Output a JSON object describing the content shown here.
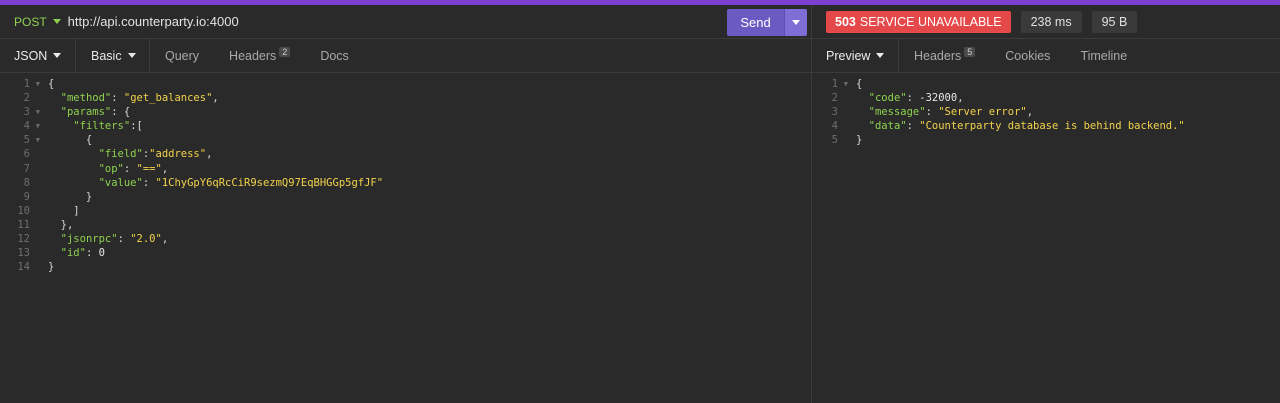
{
  "request": {
    "method": "POST",
    "url": "http://api.counterparty.io:4000",
    "send_label": "Send"
  },
  "response": {
    "status_code": "503",
    "status_text": "SERVICE UNAVAILABLE",
    "time": "238 ms",
    "size": "95 B"
  },
  "request_tabs": [
    {
      "label": "JSON"
    },
    {
      "label": "Basic"
    },
    {
      "label": "Query"
    },
    {
      "label": "Headers",
      "count": "2"
    },
    {
      "label": "Docs"
    }
  ],
  "response_tabs": [
    {
      "label": "Preview"
    },
    {
      "label": "Headers",
      "count": "5"
    },
    {
      "label": "Cookies"
    },
    {
      "label": "Timeline"
    }
  ],
  "request_body": [
    {
      "num": "1",
      "fold": true,
      "tokens": [
        {
          "t": "p",
          "v": "{"
        }
      ]
    },
    {
      "num": "2",
      "fold": false,
      "tokens": [
        {
          "t": "p",
          "v": "  "
        },
        {
          "t": "k",
          "v": "\"method\""
        },
        {
          "t": "p",
          "v": ": "
        },
        {
          "t": "s",
          "v": "\"get_balances\""
        },
        {
          "t": "p",
          "v": ","
        }
      ]
    },
    {
      "num": "3",
      "fold": true,
      "tokens": [
        {
          "t": "p",
          "v": "  "
        },
        {
          "t": "k",
          "v": "\"params\""
        },
        {
          "t": "p",
          "v": ": {"
        }
      ]
    },
    {
      "num": "4",
      "fold": true,
      "tokens": [
        {
          "t": "p",
          "v": "    "
        },
        {
          "t": "k",
          "v": "\"filters\""
        },
        {
          "t": "p",
          "v": ":["
        }
      ]
    },
    {
      "num": "5",
      "fold": true,
      "tokens": [
        {
          "t": "p",
          "v": "      {"
        }
      ]
    },
    {
      "num": "6",
      "fold": false,
      "tokens": [
        {
          "t": "p",
          "v": "        "
        },
        {
          "t": "k",
          "v": "\"field\""
        },
        {
          "t": "p",
          "v": ":"
        },
        {
          "t": "s",
          "v": "\"address\""
        },
        {
          "t": "p",
          "v": ","
        }
      ]
    },
    {
      "num": "7",
      "fold": false,
      "tokens": [
        {
          "t": "p",
          "v": "        "
        },
        {
          "t": "k",
          "v": "\"op\""
        },
        {
          "t": "p",
          "v": ": "
        },
        {
          "t": "s",
          "v": "\"==\""
        },
        {
          "t": "p",
          "v": ","
        }
      ]
    },
    {
      "num": "8",
      "fold": false,
      "tokens": [
        {
          "t": "p",
          "v": "        "
        },
        {
          "t": "k",
          "v": "\"value\""
        },
        {
          "t": "p",
          "v": ": "
        },
        {
          "t": "s",
          "v": "\"1ChyGpY6qRcCiR9sezmQ97EqBHGGp5gfJF\""
        }
      ]
    },
    {
      "num": "9",
      "fold": false,
      "tokens": [
        {
          "t": "p",
          "v": "      }"
        }
      ]
    },
    {
      "num": "10",
      "fold": false,
      "tokens": [
        {
          "t": "p",
          "v": "    ]"
        }
      ]
    },
    {
      "num": "11",
      "fold": false,
      "tokens": [
        {
          "t": "p",
          "v": "  },"
        }
      ]
    },
    {
      "num": "12",
      "fold": false,
      "tokens": [
        {
          "t": "p",
          "v": "  "
        },
        {
          "t": "k",
          "v": "\"jsonrpc\""
        },
        {
          "t": "p",
          "v": ": "
        },
        {
          "t": "s",
          "v": "\"2.0\""
        },
        {
          "t": "p",
          "v": ","
        }
      ]
    },
    {
      "num": "13",
      "fold": false,
      "tokens": [
        {
          "t": "p",
          "v": "  "
        },
        {
          "t": "k",
          "v": "\"id\""
        },
        {
          "t": "p",
          "v": ": "
        },
        {
          "t": "n",
          "v": "0"
        }
      ]
    },
    {
      "num": "14",
      "fold": false,
      "tokens": [
        {
          "t": "p",
          "v": "}"
        }
      ]
    }
  ],
  "response_body": [
    {
      "num": "1",
      "fold": true,
      "tokens": [
        {
          "t": "p",
          "v": "{"
        }
      ]
    },
    {
      "num": "2",
      "fold": false,
      "tokens": [
        {
          "t": "p",
          "v": "  "
        },
        {
          "t": "k",
          "v": "\"code\""
        },
        {
          "t": "p",
          "v": ": "
        },
        {
          "t": "n",
          "v": "-32000"
        },
        {
          "t": "p",
          "v": ","
        }
      ]
    },
    {
      "num": "3",
      "fold": false,
      "tokens": [
        {
          "t": "p",
          "v": "  "
        },
        {
          "t": "k",
          "v": "\"message\""
        },
        {
          "t": "p",
          "v": ": "
        },
        {
          "t": "s",
          "v": "\"Server error\""
        },
        {
          "t": "p",
          "v": ","
        }
      ]
    },
    {
      "num": "4",
      "fold": false,
      "tokens": [
        {
          "t": "p",
          "v": "  "
        },
        {
          "t": "k",
          "v": "\"data\""
        },
        {
          "t": "p",
          "v": ": "
        },
        {
          "t": "s",
          "v": "\"Counterparty database is behind backend.\""
        }
      ]
    },
    {
      "num": "5",
      "fold": false,
      "tokens": [
        {
          "t": "p",
          "v": "}"
        }
      ]
    }
  ],
  "colors": {
    "accent_stripe": "#7b3fd1",
    "method": "#8fd14f",
    "send_button": "#6b5ac2",
    "status_error": "#e54848",
    "json_key": "#8fd14f",
    "json_string": "#f2d24b"
  },
  "icons": {
    "method_dropdown": "caret-down-icon",
    "send_dropdown": "caret-down-icon",
    "fold": "fold-arrow-icon"
  }
}
